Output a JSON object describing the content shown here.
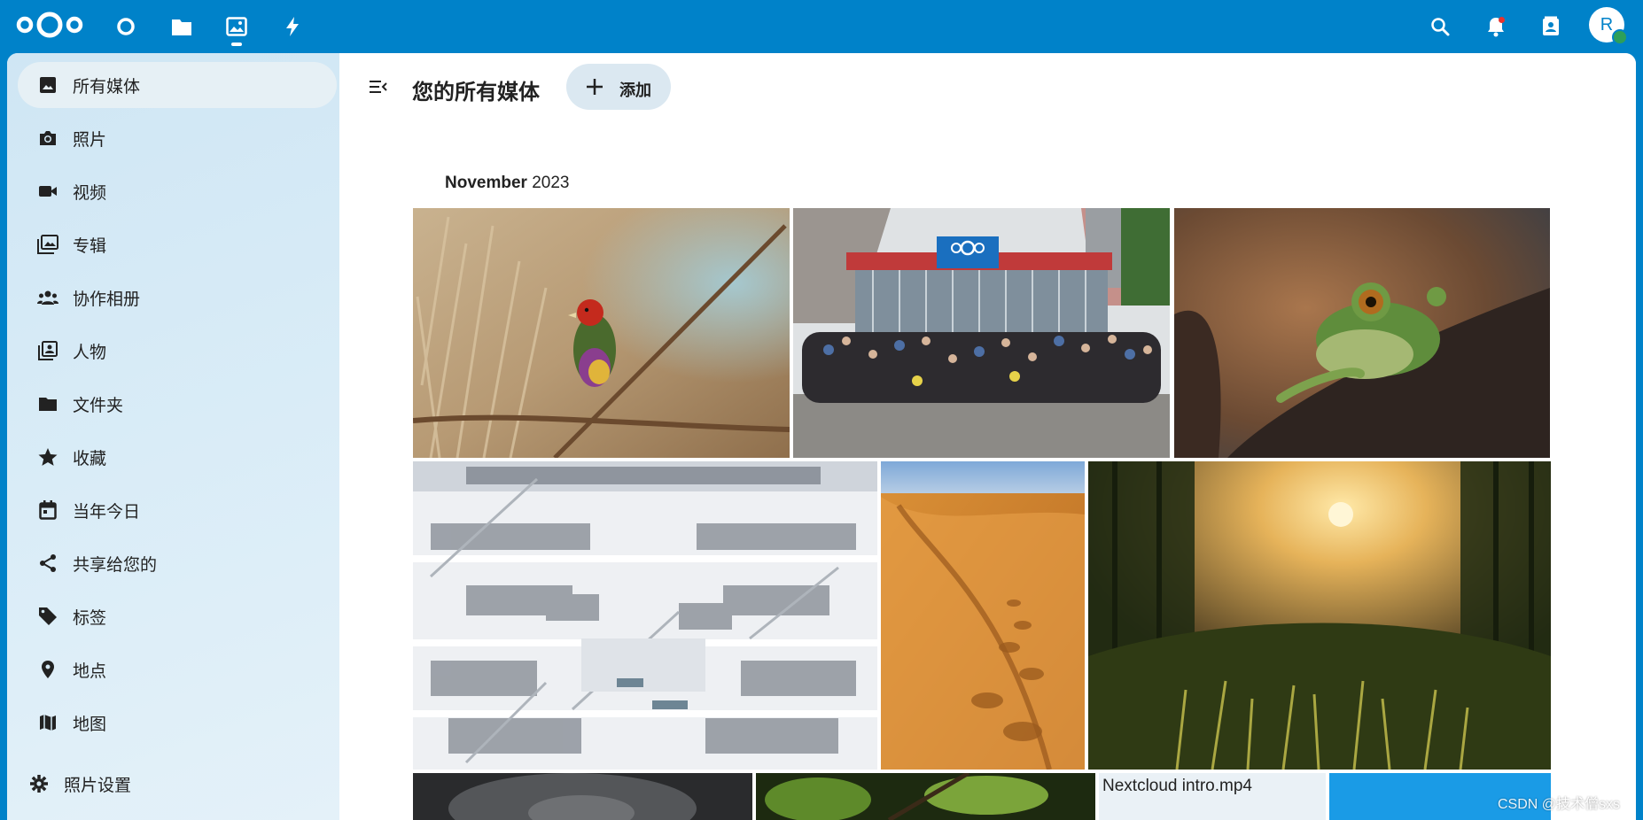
{
  "header": {
    "apps": [
      {
        "name": "dashboard-icon"
      },
      {
        "name": "files-icon"
      },
      {
        "name": "photos-icon",
        "active": true
      },
      {
        "name": "activity-icon"
      }
    ],
    "right_icons": [
      "search-icon",
      "notifications-icon",
      "contacts-icon"
    ],
    "avatar_initial": "R"
  },
  "sidebar": {
    "items": [
      {
        "label": "所有媒体",
        "icon": "image-icon",
        "active": true
      },
      {
        "label": "照片",
        "icon": "camera-icon"
      },
      {
        "label": "视频",
        "icon": "video-icon"
      },
      {
        "label": "专辑",
        "icon": "album-icon"
      },
      {
        "label": "协作相册",
        "icon": "collaborators-icon"
      },
      {
        "label": "人物",
        "icon": "people-icon"
      },
      {
        "label": "文件夹",
        "icon": "folder-icon"
      },
      {
        "label": "收藏",
        "icon": "star-icon"
      },
      {
        "label": "当年今日",
        "icon": "calendar-icon"
      },
      {
        "label": "共享给您的",
        "icon": "share-icon"
      },
      {
        "label": "标签",
        "icon": "tag-icon"
      },
      {
        "label": "地点",
        "icon": "map-marker-icon"
      },
      {
        "label": "地图",
        "icon": "map-icon"
      }
    ],
    "settings_label": "照片设置"
  },
  "main": {
    "title": "您的所有媒体",
    "add_label": "添加",
    "month": "November",
    "year": "2023",
    "tiles": [
      "bird-photo",
      "nextcloud-team-photo",
      "frog-photo",
      "library-photo",
      "desert-photo",
      "vineyard-photo",
      "gorilla-photo",
      "leaves-photo",
      "video-tile",
      "blue-tile"
    ],
    "video_name": "Nextcloud intro.mp4"
  },
  "watermark": "CSDN @技术僧sxs",
  "colors": {
    "brand": "#0082c9",
    "active_nav": "#e6f0f5",
    "add_button": "#dbe8f1"
  }
}
